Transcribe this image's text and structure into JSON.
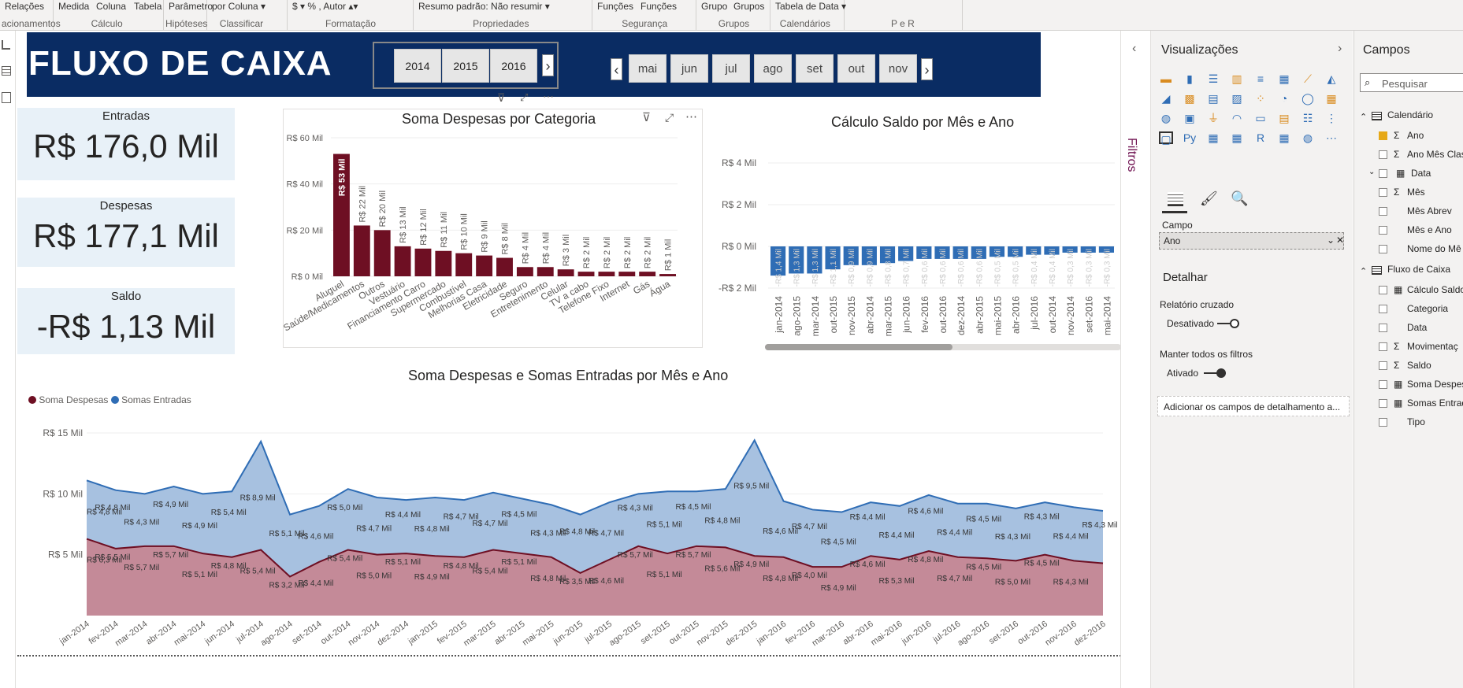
{
  "ribbon": {
    "groups": [
      {
        "buttons": [
          "Relações"
        ],
        "label": "acionamentos"
      },
      {
        "buttons": [
          "Medida",
          "Coluna",
          "Tabela"
        ],
        "label": "Cálculo"
      },
      {
        "buttons": [
          "Parâmetro"
        ],
        "label": "Hipóteses"
      },
      {
        "buttons": [
          "por Coluna ▾"
        ],
        "label": "Classificar"
      },
      {
        "buttons": [
          "$ ▾  %  ,  Autor ▴▾"
        ],
        "label": "Formatação"
      },
      {
        "buttons": [
          "Resumo padrão: Não resumir ▾"
        ],
        "label": "Propriedades"
      },
      {
        "buttons": [
          "Funções",
          "Funções"
        ],
        "label": "Segurança"
      },
      {
        "buttons": [
          "Grupo",
          "Grupos"
        ],
        "label": "Grupos"
      },
      {
        "buttons": [
          "Tabela de Data ▾"
        ],
        "label": "Calendários"
      },
      {
        "buttons": [
          ""
        ],
        "label": "P e R"
      }
    ]
  },
  "report": {
    "title": "FLUXO DE CAIXA",
    "years": [
      "2014",
      "2015",
      "2016"
    ],
    "months": [
      "mai",
      "jun",
      "jul",
      "ago",
      "set",
      "out",
      "nov"
    ],
    "kpis": [
      {
        "label": "Entradas",
        "value": "R$ 176,0 Mil"
      },
      {
        "label": "Despesas",
        "value": "R$ 177,1 Mil"
      },
      {
        "label": "Saldo",
        "value": "-R$ 1,13 Mil"
      }
    ]
  },
  "colors": {
    "banner": "#0a2c63",
    "despesas": "#6e0f23",
    "entradas": "#2f6db5",
    "despesas_area": "#c48a98",
    "entradas_area": "#a7c1e0",
    "kpi_bg": "#e8f1f8",
    "bar": "#2f6db5"
  },
  "chart_data": [
    {
      "type": "bar",
      "title": "Soma Despesas por Categoria",
      "categories": [
        "Aluguel",
        "Saúde/Medicamentos",
        "Outros",
        "Vestuário",
        "Financiamento Carro",
        "Supermercado",
        "Combustível",
        "Melhorias Casa",
        "Eletricidade",
        "Seguro",
        "Entretenimento",
        "Celular",
        "TV a cabo",
        "Telefone Fixo",
        "Internet",
        "Gás",
        "Água"
      ],
      "values": [
        53,
        22,
        20,
        13,
        12,
        11,
        10,
        9,
        8,
        4,
        4,
        3,
        2,
        2,
        2,
        2,
        1
      ],
      "data_labels": [
        "R$ 53 Mil",
        "R$ 22 Mil",
        "R$ 20 Mil",
        "R$ 13 Mil",
        "R$ 12 Mil",
        "R$ 11 Mil",
        "R$ 10 Mil",
        "R$ 9 Mil",
        "R$ 8 Mil",
        "R$ 4 Mil",
        "R$ 4 Mil",
        "R$ 3 Mil",
        "R$ 2 Mil",
        "R$ 2 Mil",
        "R$ 2 Mil",
        "R$ 2 Mil",
        "R$ 1 Mil"
      ],
      "yticks": [
        "R$ 0 Mil",
        "R$ 20 Mil",
        "R$ 40 Mil",
        "R$ 60 Mil"
      ],
      "ylim": [
        0,
        60
      ]
    },
    {
      "type": "bar",
      "title": "Cálculo Saldo por Mês e Ano",
      "categories": [
        "jan-2014",
        "ago-2015",
        "mar-2014",
        "out-2015",
        "nov-2015",
        "abr-2014",
        "mar-2015",
        "jun-2016",
        "fev-2016",
        "out-2016",
        "dez-2014",
        "abr-2015",
        "mai-2015",
        "abr-2016",
        "jul-2016",
        "out-2014",
        "nov-2014",
        "set-2016",
        "mai-2014"
      ],
      "values": [
        -1.4,
        -1.3,
        -1.3,
        -1.1,
        -0.9,
        -0.9,
        -0.8,
        -0.7,
        -0.6,
        -0.6,
        -0.6,
        -0.6,
        -0.5,
        -0.5,
        -0.4,
        -0.4,
        -0.3,
        -0.3,
        -0.3
      ],
      "data_labels": [
        "-R$ 1,4 Mil",
        "-R$ 1,3 Mil",
        "-R$ 1,3 Mil",
        "-R$ 1,1 Mil",
        "-R$ 0,9 Mil",
        "-R$ 0,9 Mil",
        "-R$ 0,8 Mil",
        "-R$ 0,7 Mil",
        "-R$ 0,6 Mil",
        "-R$ 0,6 Mil",
        "-R$ 0,6 Mil",
        "-R$ 0,6 Mil",
        "-R$ 0,5 Mil",
        "-R$ 0,5 Mil",
        "-R$ 0,4 Mil",
        "-R$ 0,4 Mil",
        "-R$ 0,3 Mil",
        "-R$ 0,3 Mil",
        "-R$ 0,3 Mil"
      ],
      "yticks": [
        "-R$ 2 Mil",
        "R$ 0 Mil",
        "R$ 2 Mil",
        "R$ 4 Mil"
      ],
      "ylim": [
        -2,
        4
      ]
    },
    {
      "type": "area",
      "title": "Soma Despesas e Somas Entradas por Mês e Ano",
      "categories": [
        "jan-2014",
        "fev-2014",
        "mar-2014",
        "abr-2014",
        "mai-2014",
        "jun-2014",
        "jul-2014",
        "ago-2014",
        "set-2014",
        "out-2014",
        "nov-2014",
        "dez-2014",
        "jan-2015",
        "fev-2015",
        "mar-2015",
        "abr-2015",
        "mai-2015",
        "jun-2015",
        "jul-2015",
        "ago-2015",
        "set-2015",
        "out-2015",
        "nov-2015",
        "dez-2015",
        "jan-2016",
        "fev-2016",
        "mar-2016",
        "abr-2016",
        "mai-2016",
        "jun-2016",
        "jul-2016",
        "ago-2016",
        "set-2016",
        "out-2016",
        "nov-2016",
        "dez-2016"
      ],
      "series": [
        {
          "name": "Soma Despesas",
          "values": [
            6.3,
            5.5,
            5.7,
            5.7,
            5.1,
            4.8,
            5.4,
            3.2,
            4.4,
            5.4,
            5.0,
            5.1,
            4.9,
            4.8,
            5.4,
            5.1,
            4.8,
            3.5,
            4.6,
            5.7,
            5.1,
            5.7,
            5.6,
            4.9,
            4.8,
            4.0,
            4.0,
            4.9,
            4.6,
            5.3,
            4.8,
            4.7,
            4.5,
            5.0,
            4.5,
            4.3
          ],
          "data_labels": [
            "R$ 6,3 Mil",
            "R$ 5,5 Mil",
            "R$ 5,7 Mil",
            "R$ 5,7 Mil",
            "R$ 5,1 Mil",
            "R$ 4,8 Mil",
            "R$ 5,4 Mil",
            "R$ 3,2 Mil",
            "R$ 4,4 Mil",
            "R$ 5,4 Mil",
            "R$ 5,0 Mil",
            "R$ 5,1 Mil",
            "R$ 4,9 Mil",
            "R$ 4,8 Mil",
            "R$ 5,4 Mil",
            "R$ 5,1 Mil",
            "R$ 4,8 Mil",
            "R$ 3,5 Mil",
            "R$ 4,6 Mil",
            "R$ 5,7 Mil",
            "R$ 5,1 Mil",
            "R$ 5,7 Mil",
            "R$ 5,6 Mil",
            "R$ 4,9 Mil",
            "R$ 4,8 Mil",
            "R$ 4,0 Mil",
            "R$ 4,9 Mil",
            "R$ 4,6 Mil",
            "R$ 5,3 Mil",
            "R$ 4,8 Mil",
            "R$ 4,7 Mil",
            "R$ 4,5 Mil",
            "R$ 5,0 Mil",
            "R$ 4,5 Mil",
            "R$ 4,3 Mil"
          ]
        },
        {
          "name": "Somas Entradas",
          "values": [
            4.8,
            4.8,
            4.3,
            4.9,
            4.9,
            5.4,
            8.9,
            5.1,
            4.6,
            5.0,
            4.7,
            4.4,
            4.8,
            4.7,
            4.7,
            4.5,
            4.3,
            4.8,
            4.7,
            4.3,
            5.1,
            4.5,
            4.8,
            9.5,
            4.6,
            4.7,
            4.5,
            4.4,
            4.4,
            4.6,
            4.4,
            4.5,
            4.3,
            4.3,
            4.4,
            4.3
          ],
          "data_labels": [
            "R$ 4,8 Mil",
            "R$ 4,8 Mil",
            "R$ 4,3 Mil",
            "R$ 4,9 Mil",
            "R$ 4,9 Mil",
            "R$ 5,4 Mil",
            "R$ 8,9 Mil",
            "R$ 5,1 Mil",
            "R$ 4,6 Mil",
            "R$ 5,0 Mil",
            "R$ 4,7 Mil",
            "R$ 4,4 Mil",
            "R$ 4,8 Mil",
            "R$ 4,7 Mil",
            "R$ 4,7 Mil",
            "R$ 4,5 Mil",
            "R$ 4,3 Mil",
            "R$ 4,8 Mil",
            "R$ 4,7 Mil",
            "R$ 4,3 Mil",
            "R$ 5,1 Mil",
            "R$ 4,5 Mil",
            "R$ 4,8 Mil",
            "R$ 9,5 Mil",
            "R$ 4,6 Mil",
            "R$ 4,7 Mil",
            "R$ 4,5 Mil",
            "R$ 4,4 Mil",
            "R$ 4,4 Mil",
            "R$ 4,6 Mil",
            "R$ 4,4 Mil",
            "R$ 4,5 Mil",
            "R$ 4,3 Mil",
            "R$ 4,3 Mil",
            "R$ 4,4 Mil",
            "R$ 4,3 Mil"
          ]
        }
      ],
      "yticks": [
        "R$ 5 Mil",
        "R$ 10 Mil",
        "R$ 15 Mil"
      ],
      "ylim": [
        0,
        15
      ],
      "legend": "top-left",
      "stacked": true
    }
  ],
  "filters": {
    "label": "Filtros"
  },
  "visualizations": {
    "title": "Visualizações",
    "campo_label": "Campo",
    "campo_value": "Ano",
    "detalhar": "Detalhar",
    "relatorio_cruzado": "Relatório cruzado",
    "desativado": "Desativado",
    "manter_filtros": "Manter todos os filtros",
    "ativado": "Ativado",
    "add_drill": "Adicionar os campos de detalhamento a..."
  },
  "fields": {
    "title": "Campos",
    "search_placeholder": "Pesquisar",
    "tables": [
      {
        "name": "Calendário",
        "items": [
          {
            "name": "Ano",
            "checked": true,
            "sigma": true
          },
          {
            "name": "Ano Mês Clas",
            "sigma": true
          },
          {
            "name": "Data",
            "group": true
          },
          {
            "name": "Mês",
            "sigma": true
          },
          {
            "name": "Mês Abrev"
          },
          {
            "name": "Mês e Ano"
          },
          {
            "name": "Nome do Mê"
          }
        ]
      },
      {
        "name": "Fluxo de Caixa",
        "items": [
          {
            "name": "Cálculo Saldo",
            "calc": true
          },
          {
            "name": "Categoria"
          },
          {
            "name": "Data"
          },
          {
            "name": "Movimentaç",
            "sigma": true
          },
          {
            "name": "Saldo",
            "sigma": true
          },
          {
            "name": "Soma Despes",
            "calc": true
          },
          {
            "name": "Somas Entrad",
            "calc": true
          },
          {
            "name": "Tipo"
          }
        ]
      }
    ]
  }
}
